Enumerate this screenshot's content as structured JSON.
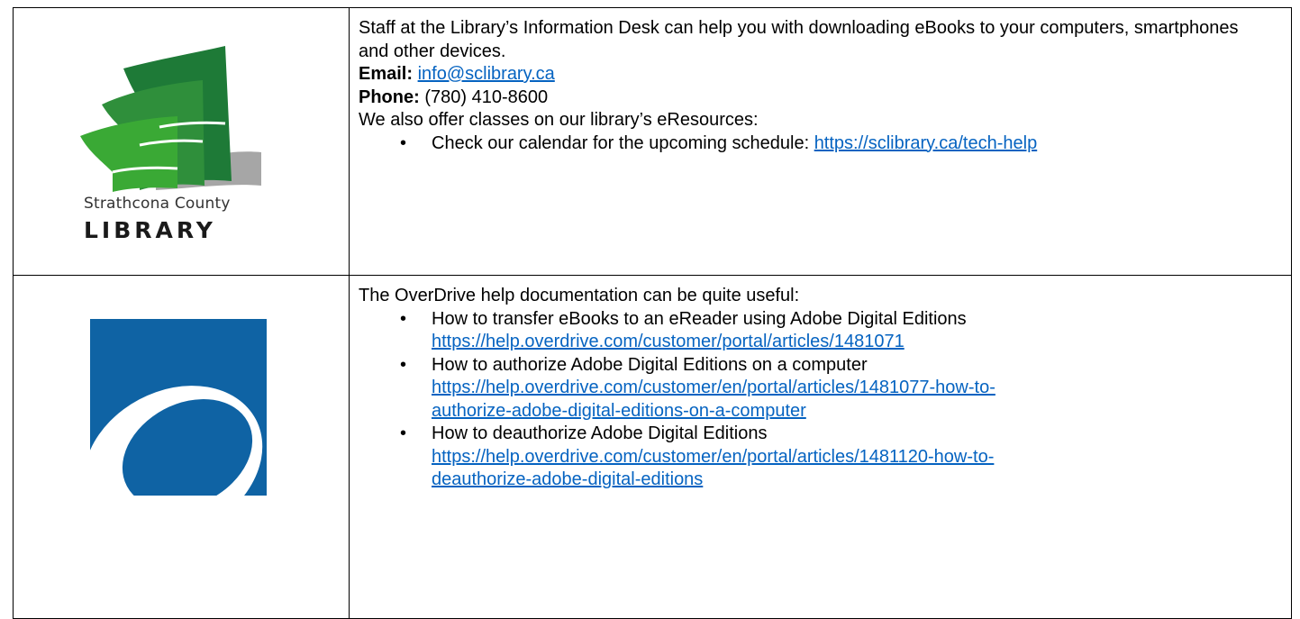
{
  "logos": {
    "library": {
      "icon": "strathcona-library-logo-icon",
      "line1": "Strathcona County",
      "line2": "LIBRARY",
      "colors": {
        "dark_green": "#1e7a37",
        "light_green": "#3aa935",
        "gray": "#a6a6a6"
      }
    },
    "overdrive": {
      "icon": "overdrive-logo-icon",
      "colors": {
        "blue": "#0f63a4",
        "white": "#ffffff"
      }
    }
  },
  "row1": {
    "intro": "Staff at the Library’s Information Desk can help you with downloading eBooks to your computers, smartphones and other devices.",
    "email_label": "Email:",
    "email_value": "info@sclibrary.ca",
    "phone_label": "Phone:",
    "phone_value": " (780) 410-8600",
    "classes_text": "We also offer classes on our library’s eResources:",
    "bullet1_text": "Check our calendar for the upcoming schedule: ",
    "bullet1_link": "https://sclibrary.ca/tech-help"
  },
  "row2": {
    "intro": "The OverDrive help documentation can be quite useful:",
    "items": [
      {
        "title": "How to transfer eBooks to an eReader using Adobe Digital Editions",
        "link_line1": "https://help.overdrive.com/customer/portal/articles/1481071",
        "link_line2": ""
      },
      {
        "title": "How to authorize Adobe Digital Editions on a computer",
        "link_line1": "https://help.overdrive.com/customer/en/portal/articles/1481077-how-to-",
        "link_line2": "authorize-adobe-digital-editions-on-a-computer"
      },
      {
        "title": "How to deauthorize Adobe Digital Editions",
        "link_line1": "https://help.overdrive.com/customer/en/portal/articles/1481120-how-to-",
        "link_line2": "deauthorize-adobe-digital-editions"
      }
    ],
    "bullet_glyph": "•"
  },
  "links_color": "#0563c1"
}
